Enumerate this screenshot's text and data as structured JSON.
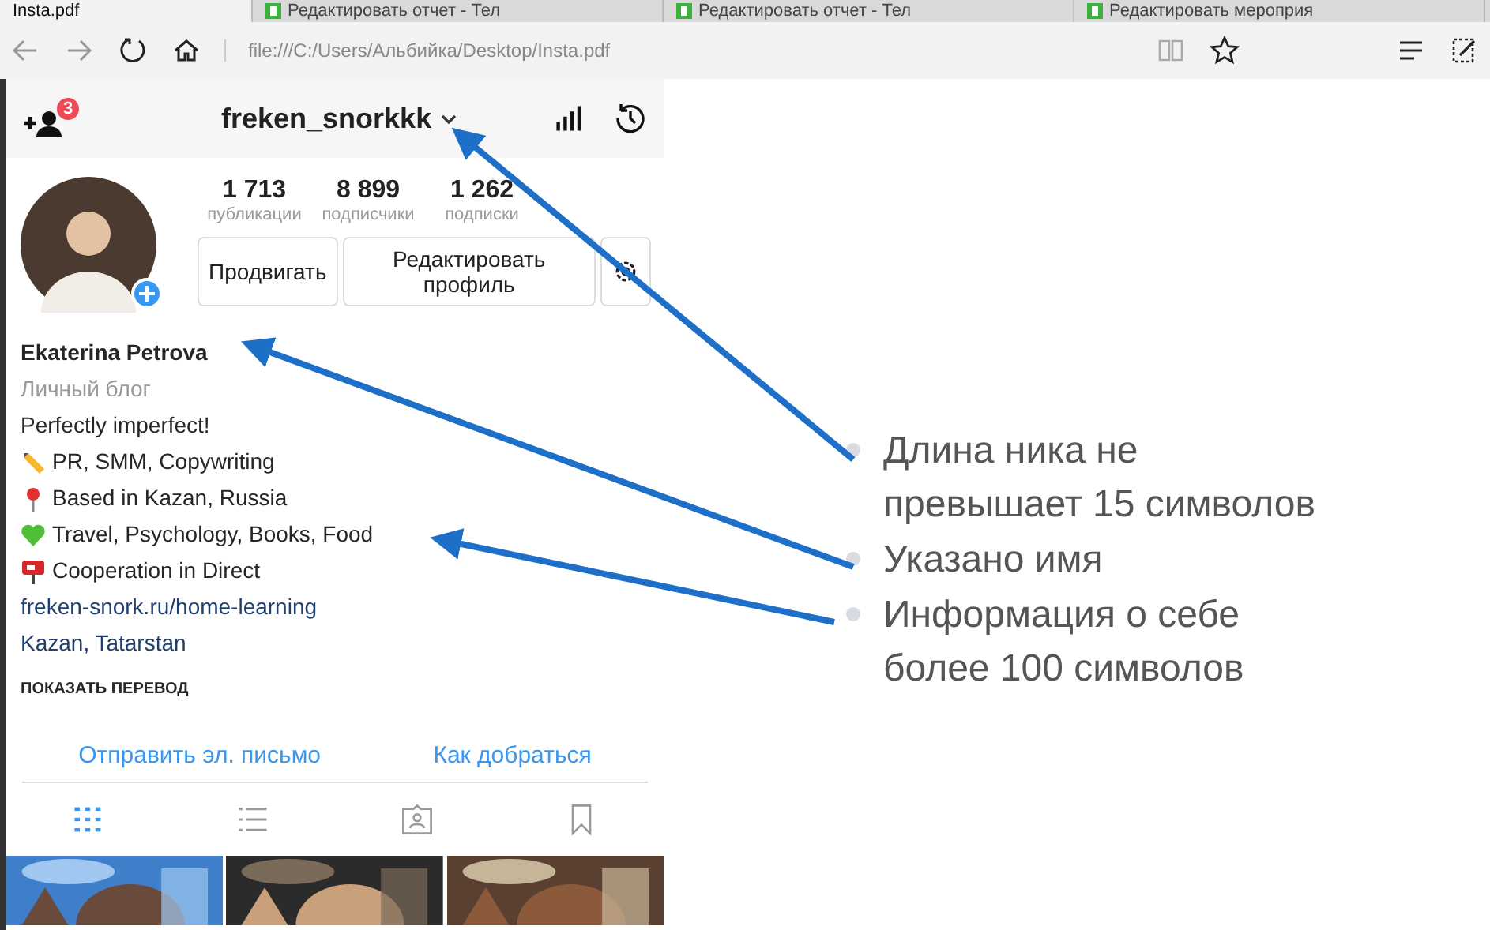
{
  "browser": {
    "tabs": [
      {
        "title": "Insta.pdf",
        "selected": true
      },
      {
        "title": "Редактировать отчет - Тел",
        "selected": false
      },
      {
        "title": "Редактировать отчет - Тел",
        "selected": false
      },
      {
        "title": "Редактировать мероприя",
        "selected": false
      }
    ],
    "address": "file:///C:/Users/Альбийка/Desktop/Insta.pdf"
  },
  "profile": {
    "username": "freken_snorkkk",
    "notification_count": "3",
    "stats": [
      {
        "value": "1 713",
        "label": "публикации"
      },
      {
        "value": "8 899",
        "label": "подписчики"
      },
      {
        "value": "1 262",
        "label": "подписки"
      }
    ],
    "buttons": [
      "Продвигать",
      "Редактировать профиль"
    ],
    "name": "Ekaterina Petrova",
    "category": "Личный блог",
    "tagline": "Perfectly imperfect!",
    "bio_lines": [
      {
        "kind": "pencil",
        "text": "PR, SMM, Copywriting"
      },
      {
        "kind": "pin",
        "text": "Based in Kazan, Russia"
      },
      {
        "kind": "heart",
        "text": "Travel, Psychology, Books, Food"
      },
      {
        "kind": "mailbox",
        "text": "Cooperation in Direct"
      }
    ],
    "link": "freken-snork.ru/home-learning",
    "location": "Kazan, Tatarstan",
    "translate": "ПОКАЗАТЬ ПЕРЕВОД",
    "contacts": [
      "Отправить эл. письмо",
      "Как добраться"
    ],
    "view_tabs": [
      {
        "kind": "grid",
        "selected": true
      },
      {
        "kind": "list",
        "selected": false
      },
      {
        "kind": "tagged",
        "selected": false
      },
      {
        "kind": "saved",
        "selected": false
      }
    ],
    "photos": [
      {
        "kind": "picture"
      },
      {
        "kind": "picture"
      },
      {
        "kind": "picture"
      }
    ]
  },
  "annotations": [
    {
      "text": "Длина ника не превышает 15 символов"
    },
    {
      "text": "Указано имя"
    },
    {
      "text": "Информация о себе более 100 символов"
    }
  ]
}
